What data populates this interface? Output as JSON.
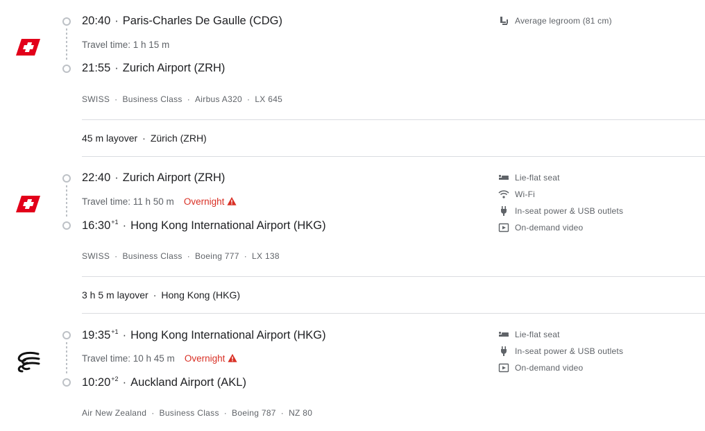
{
  "segments": [
    {
      "airline_logo": "swiss-logo-icon",
      "departure": {
        "time": "20:40",
        "day_offset": "",
        "airport": "Paris-Charles De Gaulle (CDG)"
      },
      "travel_time": "Travel time: 1 h 15 m",
      "overnight": "",
      "arrival": {
        "time": "21:55",
        "day_offset": "",
        "airport": "Zurich Airport (ZRH)"
      },
      "airline": "SWISS",
      "cabin": "Business Class",
      "aircraft": "Airbus A320",
      "flight_number": "LX 645",
      "amenities": [
        {
          "icon": "legroom-icon",
          "label": "Average legroom (81 cm)"
        }
      ]
    },
    {
      "airline_logo": "swiss-logo-icon",
      "departure": {
        "time": "22:40",
        "day_offset": "",
        "airport": "Zurich Airport (ZRH)"
      },
      "travel_time": "Travel time: 11 h 50 m",
      "overnight": "Overnight",
      "arrival": {
        "time": "16:30",
        "day_offset": "+1",
        "airport": "Hong Kong International Airport (HKG)"
      },
      "airline": "SWISS",
      "cabin": "Business Class",
      "aircraft": "Boeing 777",
      "flight_number": "LX 138",
      "amenities": [
        {
          "icon": "lie-flat-seat-icon",
          "label": "Lie-flat seat"
        },
        {
          "icon": "wifi-icon",
          "label": "Wi-Fi"
        },
        {
          "icon": "power-plug-icon",
          "label": "In-seat power & USB outlets"
        },
        {
          "icon": "video-icon",
          "label": "On-demand video"
        }
      ]
    },
    {
      "airline_logo": "air-new-zealand-koru-icon",
      "departure": {
        "time": "19:35",
        "day_offset": "+1",
        "airport": "Hong Kong International Airport (HKG)"
      },
      "travel_time": "Travel time: 10 h 45 m",
      "overnight": "Overnight",
      "arrival": {
        "time": "10:20",
        "day_offset": "+2",
        "airport": "Auckland Airport (AKL)"
      },
      "airline": "Air New Zealand",
      "cabin": "Business Class",
      "aircraft": "Boeing 787",
      "flight_number": "NZ 80",
      "amenities": [
        {
          "icon": "lie-flat-seat-icon",
          "label": "Lie-flat seat"
        },
        {
          "icon": "power-plug-icon",
          "label": "In-seat power & USB outlets"
        },
        {
          "icon": "video-icon",
          "label": "On-demand video"
        }
      ]
    }
  ],
  "layovers": [
    {
      "duration": "45 m layover",
      "location": "Zürich (ZRH)"
    },
    {
      "duration": "3 h 5 m layover",
      "location": "Hong Kong (HKG)"
    }
  ],
  "colors": {
    "swiss_red": "#e2001a",
    "overnight_red": "#d93025",
    "secondary_text": "#5f6368",
    "divider": "#dadce0"
  }
}
